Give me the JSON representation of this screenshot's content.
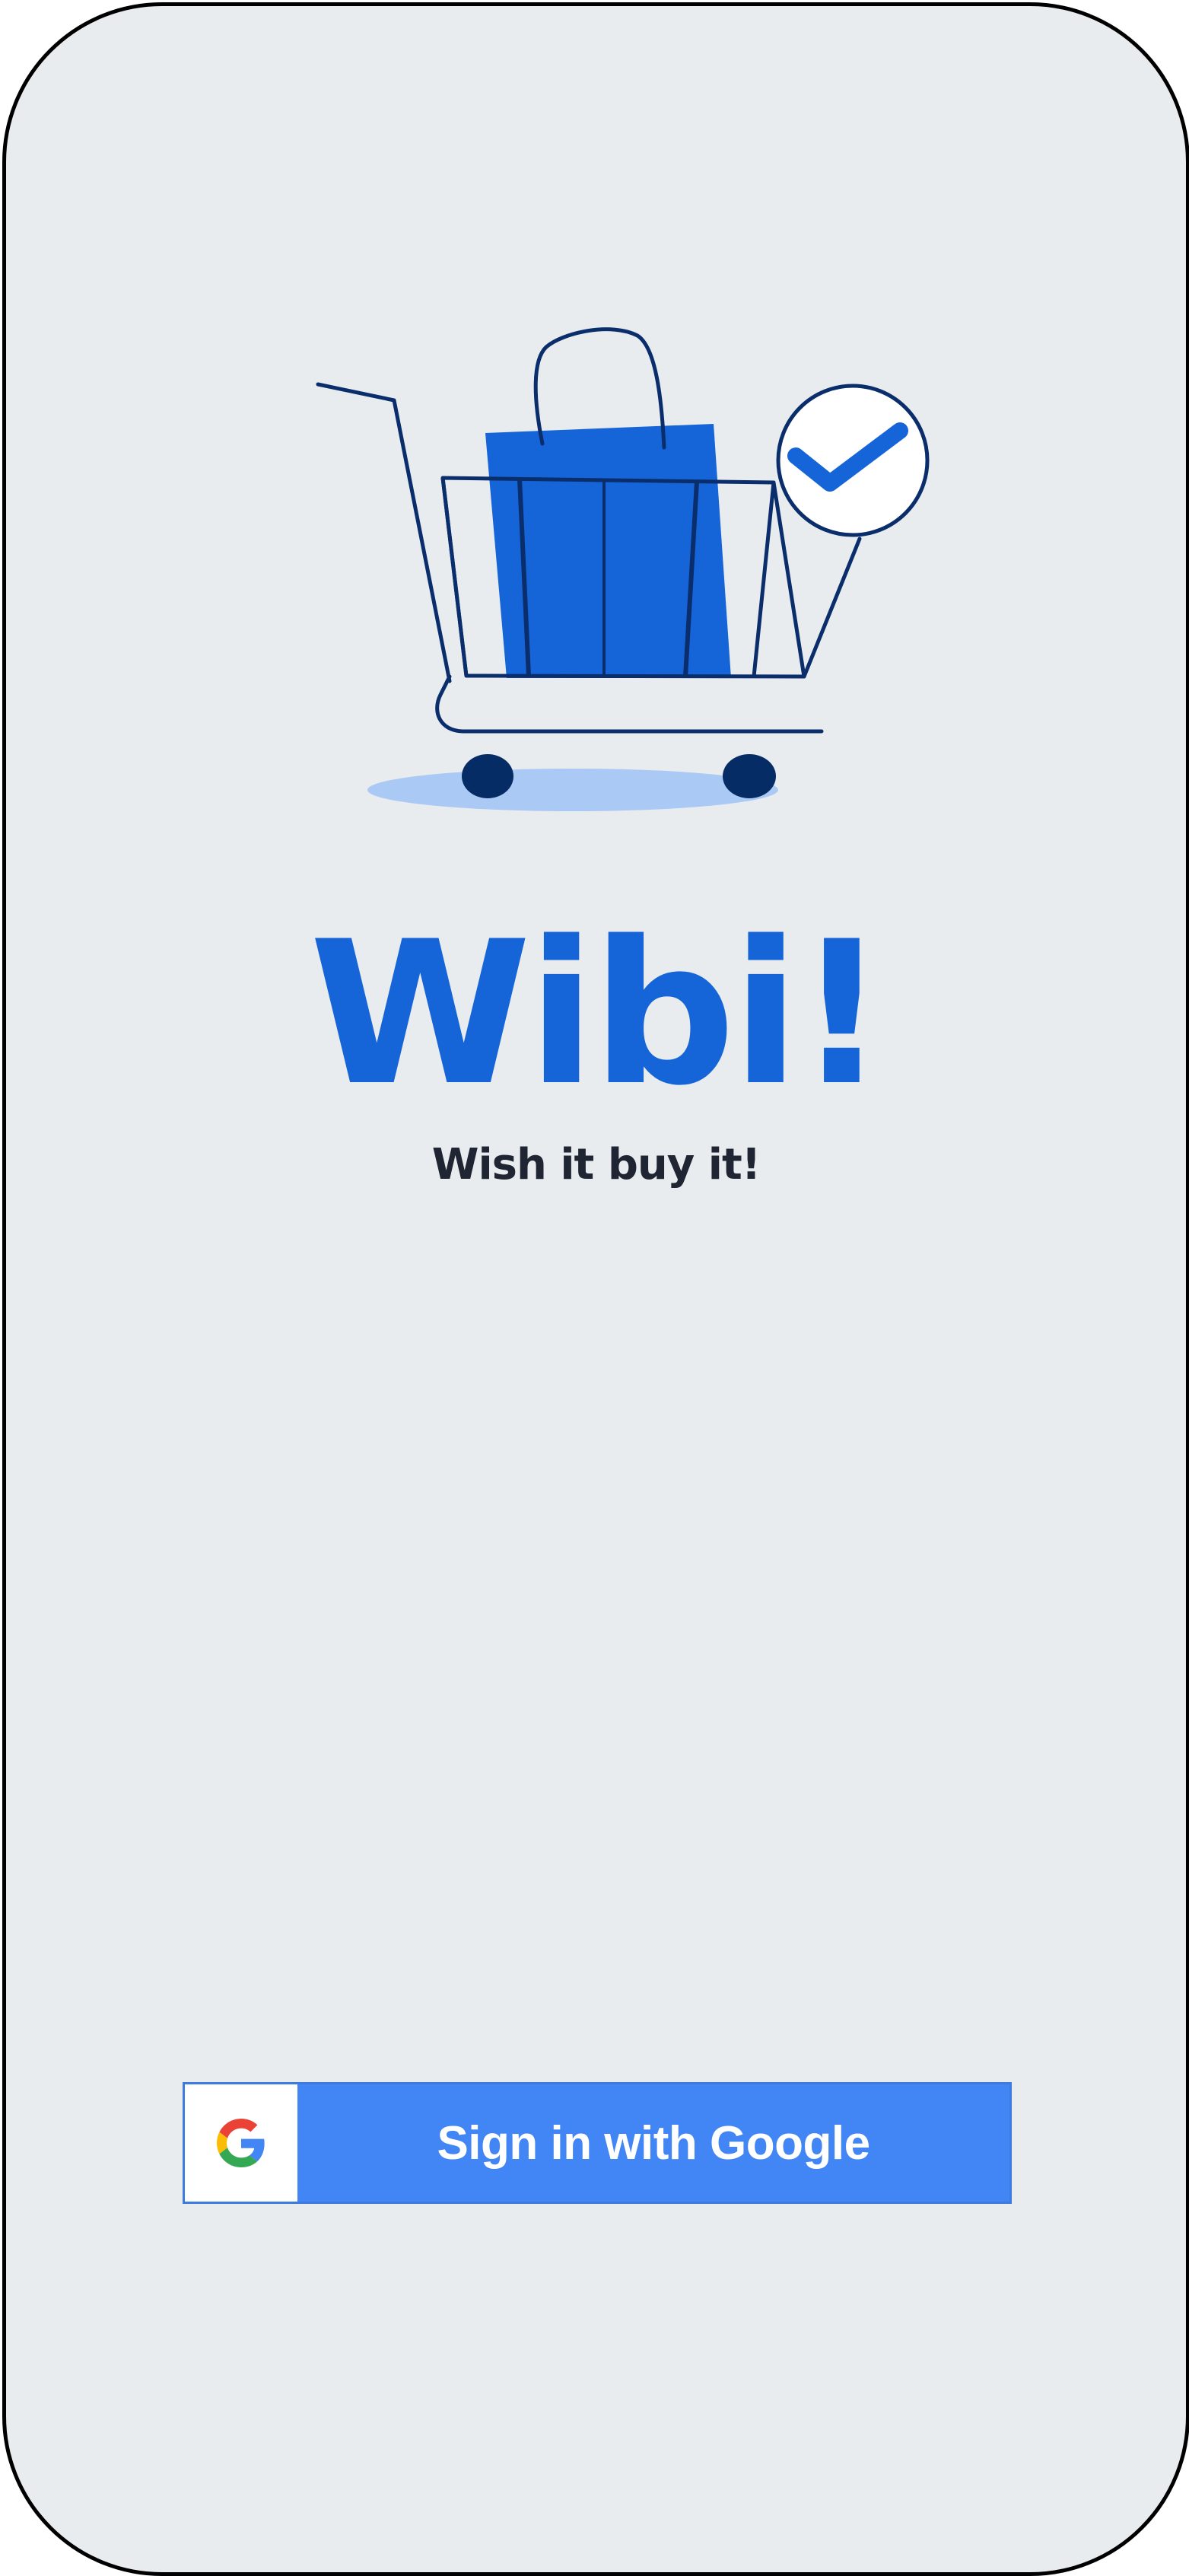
{
  "app": {
    "title": "Wibi!",
    "tagline": "Wish it buy it!"
  },
  "illustration": {
    "icon": "shopping-cart-with-bag-and-checkmark",
    "colors": {
      "bag": "#1565d8",
      "outline": "#0a2d6b",
      "wheels": "#062c66",
      "shadow": "#abc9f5",
      "check": "#1565d8"
    }
  },
  "signin": {
    "label": "Sign in with Google",
    "icon": "google-g-icon",
    "colors": {
      "button": "#4285f4",
      "text": "#ffffff"
    }
  }
}
